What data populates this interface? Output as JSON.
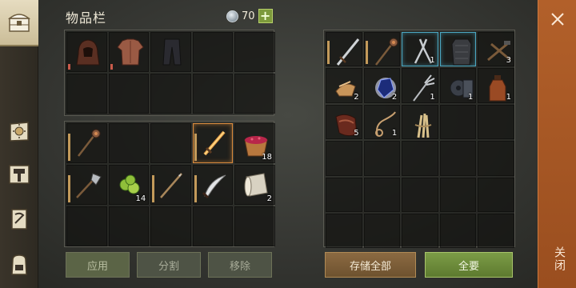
{
  "header": {
    "title": "物品栏",
    "currency_count": "70",
    "add_label": "+"
  },
  "tabs": [
    {
      "name": "chest",
      "active": true
    },
    {
      "name": "journal"
    },
    {
      "name": "crafting"
    },
    {
      "name": "map-scroll"
    },
    {
      "name": "backpack"
    }
  ],
  "inventory": {
    "equipment": [
      {
        "item": "hood",
        "dura": "low"
      },
      {
        "item": "tunic",
        "dura": "low"
      },
      {
        "item": "pants"
      },
      {},
      {},
      {},
      {},
      {},
      {},
      {}
    ],
    "bag": [
      {
        "item": "mace",
        "dura": "high"
      },
      {},
      {},
      {
        "item": "fire-sword",
        "dura": "high",
        "selected": true
      },
      {
        "item": "berry-bowl",
        "count": "18"
      },
      {
        "item": "halberd",
        "dura": "high"
      },
      {
        "item": "cucumber-slices",
        "count": "14"
      },
      {
        "item": "spear",
        "dura": "high"
      },
      {
        "item": "scimitar",
        "dura": "high"
      },
      {
        "item": "cloth-roll",
        "count": "2"
      },
      {},
      {},
      {},
      {},
      {}
    ],
    "buttons": {
      "apply": "应用",
      "split": "分割",
      "remove": "移除"
    }
  },
  "storage": {
    "slots": [
      {
        "item": "sword",
        "dura": "high"
      },
      {
        "item": "mace",
        "dura": "high"
      },
      {
        "item": "tongs",
        "count": "1",
        "blue": true
      },
      {
        "item": "chainmail",
        "blue": true
      },
      {
        "item": "tools",
        "count": "3"
      },
      {
        "item": "wood-chips",
        "count": "2"
      },
      {
        "item": "crystal",
        "count": "2"
      },
      {
        "item": "pitchfork",
        "count": "1"
      },
      {
        "item": "gear-machine",
        "count": "1"
      },
      {
        "item": "bottle",
        "count": "1"
      },
      {
        "item": "leather-strips",
        "count": "5"
      },
      {
        "item": "rope",
        "count": "1"
      },
      {
        "item": "wheat-bundle"
      },
      {},
      {},
      {},
      {},
      {},
      {},
      {},
      {},
      {},
      {},
      {},
      {},
      {},
      {},
      {},
      {},
      {}
    ],
    "buttons": {
      "store_all": "存储全部",
      "take_all": "全要"
    }
  },
  "close": {
    "label": "关闭"
  },
  "colors": {
    "accent_orange": "#b2602a",
    "green": "#7c9c47",
    "brown": "#8b6a42"
  }
}
